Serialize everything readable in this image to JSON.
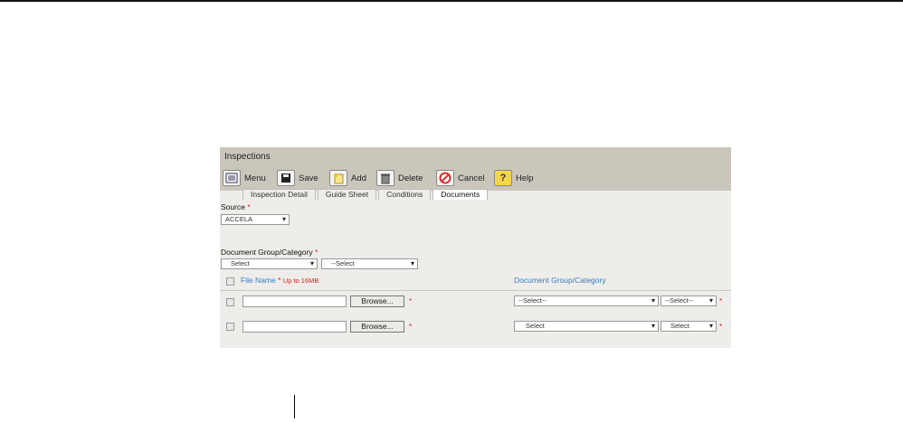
{
  "window": {
    "title": "Inspections"
  },
  "toolbar": {
    "menu": "Menu",
    "save": "Save",
    "add": "Add",
    "delete": "Delete",
    "cancel": "Cancel",
    "help": "Help"
  },
  "tabs": [
    "Inspection Detail",
    "Guide Sheet",
    "Conditions",
    "Documents"
  ],
  "active_tab": "Documents",
  "form": {
    "source_label": "Source",
    "source_value": "ACCELA",
    "required_mark": "*",
    "doc_group_label": "Document Group/Category",
    "group_select": "Select",
    "category_select": "--Select"
  },
  "table": {
    "file_name_header": "File Name",
    "size_limit": "Up to 16MB",
    "doc_group_header": "Document Group/Category",
    "rows": [
      {
        "browse": "Browse...",
        "group": "--Select--",
        "category": "--Select--"
      },
      {
        "browse": "Browse...",
        "group": "Select",
        "category": "Select"
      }
    ]
  },
  "colors": {
    "header_bg": "#cbc6bb",
    "panel_bg": "#eeede9",
    "link_blue": "#3a7ec2",
    "required_red": "#d42020"
  }
}
